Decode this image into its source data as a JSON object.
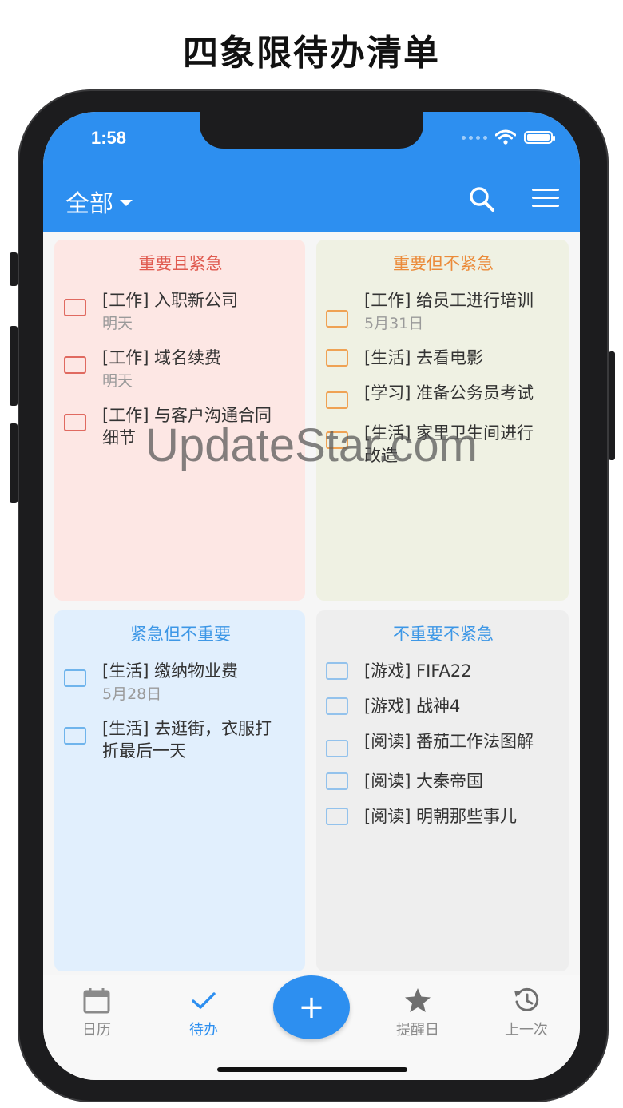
{
  "page_title": "四象限待办清单",
  "status_bar": {
    "time": "1:58"
  },
  "header": {
    "filter_label": "全部"
  },
  "quadrants": [
    {
      "title": "重要且紧急",
      "tasks": [
        {
          "text": "[工作] 入职新公司",
          "date": "明天"
        },
        {
          "text": "[工作] 域名续费",
          "date": "明天"
        },
        {
          "text": "[工作] 与客户沟通合同细节",
          "date": ""
        }
      ]
    },
    {
      "title": "重要但不紧急",
      "tasks": [
        {
          "text": "[工作] 给员工进行培训",
          "date": "5月31日"
        },
        {
          "text": "[生活] 去看电影",
          "date": ""
        },
        {
          "text": "[学习] 准备公务员考试",
          "date": ""
        },
        {
          "text": "[生活] 家里卫生间进行改造",
          "date": ""
        }
      ]
    },
    {
      "title": "紧急但不重要",
      "tasks": [
        {
          "text": "[生活] 缴纳物业费",
          "date": "5月28日"
        },
        {
          "text": "[生活] 去逛街，衣服打折最后一天",
          "date": ""
        }
      ]
    },
    {
      "title": "不重要不紧急",
      "tasks": [
        {
          "text": "[游戏] FIFA22",
          "date": ""
        },
        {
          "text": "[游戏] 战神4",
          "date": ""
        },
        {
          "text": "[阅读] 番茄工作法图解",
          "date": ""
        },
        {
          "text": "[阅读] 大秦帝国",
          "date": ""
        },
        {
          "text": "[阅读] 明朝那些事儿",
          "date": ""
        }
      ]
    }
  ],
  "watermark": "UpdateStar.com",
  "bottom_nav": {
    "items": [
      {
        "label": "日历",
        "icon": "calendar-icon"
      },
      {
        "label": "待办",
        "icon": "check-icon"
      },
      {
        "label": "提醒日",
        "icon": "star-icon"
      },
      {
        "label": "上一次",
        "icon": "history-icon"
      }
    ],
    "fab_symbol": "+"
  },
  "colors": {
    "primary": "#2d8ff0",
    "q1_bg": "#fde7e4",
    "q1_accent": "#e05a4f",
    "q2_bg": "#eff1e3",
    "q2_accent": "#eb8b3a",
    "q3_bg": "#e1effd",
    "q3_accent": "#3d97e6",
    "q4_bg": "#eeeeee",
    "q4_accent": "#3d97e6"
  }
}
